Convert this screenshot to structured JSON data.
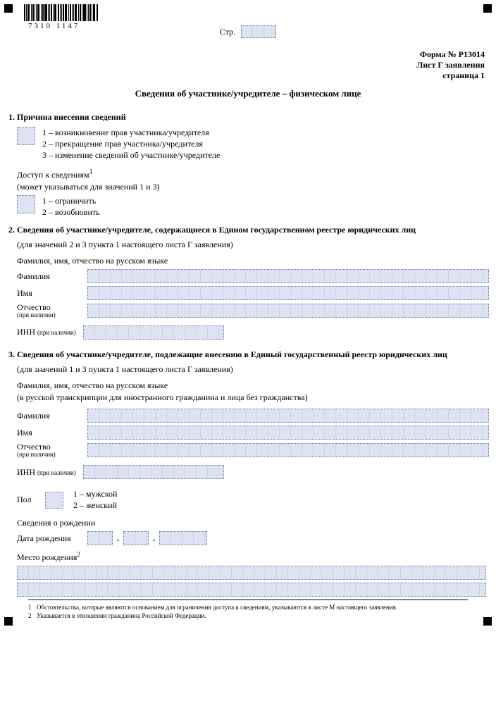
{
  "barcode_number": "7310 1147",
  "page_label": "Стр.",
  "form_header": {
    "line1": "Форма № Р13014",
    "line2": "Лист Г заявления",
    "line3": "страница 1"
  },
  "title": "Сведения об участнике/учредителе – физическом лице",
  "s1": {
    "head": "1. Причина внесения сведений",
    "opt1": "1 – возникновение прав участника/учредителя",
    "opt2": "2 – прекращение прав участника/учредителя",
    "opt3": "3 – изменение сведений об участнике/учредителе",
    "access_head": "Доступ к сведениям",
    "access_note": "(может указываться для значений 1 и 3)",
    "access_sup": "1",
    "access_opt1": "1 – ограничить",
    "access_opt2": "2 – возобновить"
  },
  "s2": {
    "head": "2. Сведения об участнике/учредителе, содержащиеся в Едином государственном реестре юридических лиц",
    "sub": "(для значений 2 и 3 пункта 1 настоящего листа Г заявления)",
    "fio_head": "Фамилия, имя, отчество на русском языке",
    "surname": "Фамилия",
    "name": "Имя",
    "patronymic": "Отчество",
    "if_present": "(при наличии)",
    "inn": "ИНН"
  },
  "s3": {
    "head": "3. Сведения об участнике/учредителе, подлежащие внесению в Единый государственный реестр юридических лиц",
    "sub": "(для значений 1 и 3 пункта 1 настоящего листа Г заявления)",
    "fio_head": "Фамилия, имя, отчество на русском языке",
    "fio_sub": "(в русской транскрипции для иностранного гражданина и лица без гражданства)",
    "surname": "Фамилия",
    "name": "Имя",
    "patronymic": "Отчество",
    "if_present": "(при наличии)",
    "inn": "ИНН",
    "gender_label": "Пол",
    "gender_opt1": "1 – мужской",
    "gender_opt2": "2 – женский",
    "birth_head": "Сведения о рождении",
    "dob_label": "Дата рождения",
    "place_label": "Место рождения",
    "place_sup": "2"
  },
  "footnotes": {
    "f1_num": "1",
    "f1": "Обстоятельства, которые являются основанием для ограничения доступа к сведениям, указываются в листе М настоящего заявления.",
    "f2_num": "2",
    "f2": "Указывается в отношении гражданина Российской Федерации."
  }
}
